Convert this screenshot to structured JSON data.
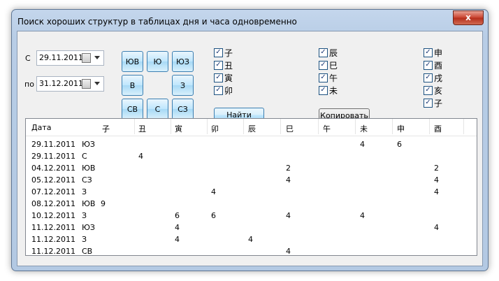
{
  "window": {
    "title": "Поиск хороших структур в таблицах дня и часа одновременно",
    "close_glyph": "x"
  },
  "dates": {
    "from_label": "С",
    "from_value": "29.11.2011",
    "to_label": "по",
    "to_value": "31.12.2011"
  },
  "directions": {
    "sw": "ЮВ",
    "s": "Ю",
    "se": "ЮЗ",
    "e": "В",
    "w": "З",
    "ne": "СВ",
    "n": "С",
    "nw": "СЗ"
  },
  "checkboxes": {
    "col1": [
      "子",
      "丑",
      "寅",
      "卯"
    ],
    "col2": [
      "辰",
      "巳",
      "午",
      "未"
    ],
    "col3": [
      "申",
      "酉",
      "戌",
      "亥",
      "子"
    ],
    "check_glyph": "✓"
  },
  "buttons": {
    "find": "Найти",
    "copy": "Копировать"
  },
  "table": {
    "headers": [
      "Дата",
      "子",
      "丑",
      "寅",
      "卯",
      "辰",
      "巳",
      "午",
      "未",
      "申",
      "酉"
    ],
    "rows": [
      [
        "29.11.2011",
        "ЮЗ",
        "",
        "",
        "",
        "",
        "",
        "",
        "",
        "4",
        "6",
        ""
      ],
      [
        "29.11.2011",
        "С",
        "",
        "4",
        "",
        "",
        "",
        "",
        "",
        "",
        "",
        ""
      ],
      [
        "04.12.2011",
        "ЮВ",
        "",
        "",
        "",
        "",
        "",
        "2",
        "",
        "",
        "",
        "2"
      ],
      [
        "05.12.2011",
        "СЗ",
        "",
        "",
        "",
        "",
        "",
        "4",
        "",
        "",
        "",
        "4"
      ],
      [
        "07.12.2011",
        "З",
        "",
        "",
        "",
        "4",
        "",
        "",
        "",
        "",
        "",
        "4"
      ],
      [
        "08.12.2011",
        "ЮВ",
        "9",
        "",
        "",
        "",
        "",
        "",
        "",
        "",
        "",
        ""
      ],
      [
        "10.12.2011",
        "З",
        "",
        "",
        "6",
        "6",
        "",
        "4",
        "",
        "4",
        "",
        ""
      ],
      [
        "11.12.2011",
        "ЮЗ",
        "",
        "",
        "4",
        "",
        "",
        "",
        "",
        "",
        "",
        "4"
      ],
      [
        "11.12.2011",
        "З",
        "",
        "",
        "4",
        "",
        "4",
        "",
        "",
        "",
        "",
        ""
      ],
      [
        "11.12.2011",
        "СВ",
        "",
        "",
        "",
        "",
        "",
        "4",
        "",
        "",
        "",
        ""
      ]
    ]
  }
}
